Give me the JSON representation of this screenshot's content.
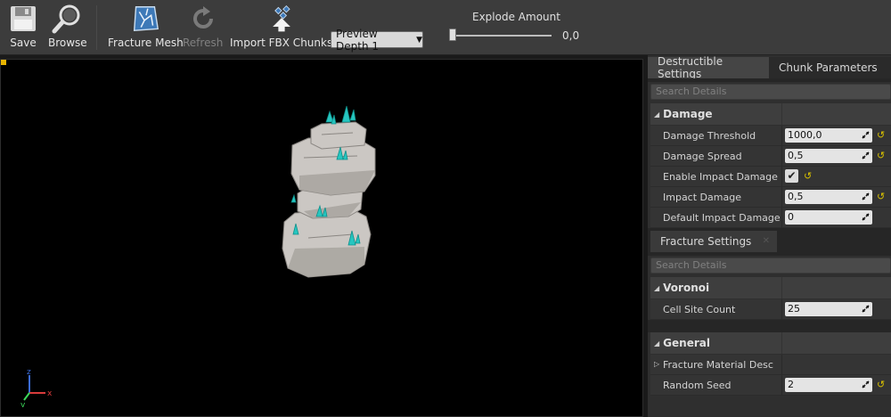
{
  "toolbar": {
    "save_label": "Save",
    "browse_label": "Browse",
    "fracture_label": "Fracture Mesh",
    "refresh_label": "Refresh",
    "import_label": "Import FBX Chunks",
    "preview_depth": "Preview Depth 1",
    "explode_label": "Explode Amount",
    "explode_value": "0,0",
    "explode_level": 0.0
  },
  "panel": {
    "tabs": [
      "Destructible Settings",
      "Chunk Parameters"
    ],
    "search_placeholder": "Search Details",
    "damage": {
      "header": "Damage",
      "rows": [
        {
          "label": "Damage Threshold",
          "value": "1000,0"
        },
        {
          "label": "Damage Spread",
          "value": "0,5"
        },
        {
          "label": "Enable Impact Damage",
          "checked": true
        },
        {
          "label": "Impact Damage",
          "value": "0,5"
        },
        {
          "label": "Default Impact Damage Dep",
          "value": "0"
        }
      ]
    },
    "fracture_tab": "Fracture Settings",
    "fracture_search": "Search Details",
    "voronoi": {
      "header": "Voronoi",
      "rows": [
        {
          "label": "Cell Site Count",
          "value": "25"
        }
      ]
    },
    "general": {
      "header": "General",
      "rows": [
        {
          "label": "Fracture Material Desc"
        },
        {
          "label": "Random Seed",
          "value": "2"
        }
      ]
    }
  },
  "colors": {
    "accent_yellow": "#e8b400",
    "crystal": "#26c6c0",
    "rock": "#cbc7c3"
  },
  "icons": [
    "save-icon",
    "browse-icon",
    "fracture-icon",
    "refresh-icon",
    "import-icon"
  ]
}
